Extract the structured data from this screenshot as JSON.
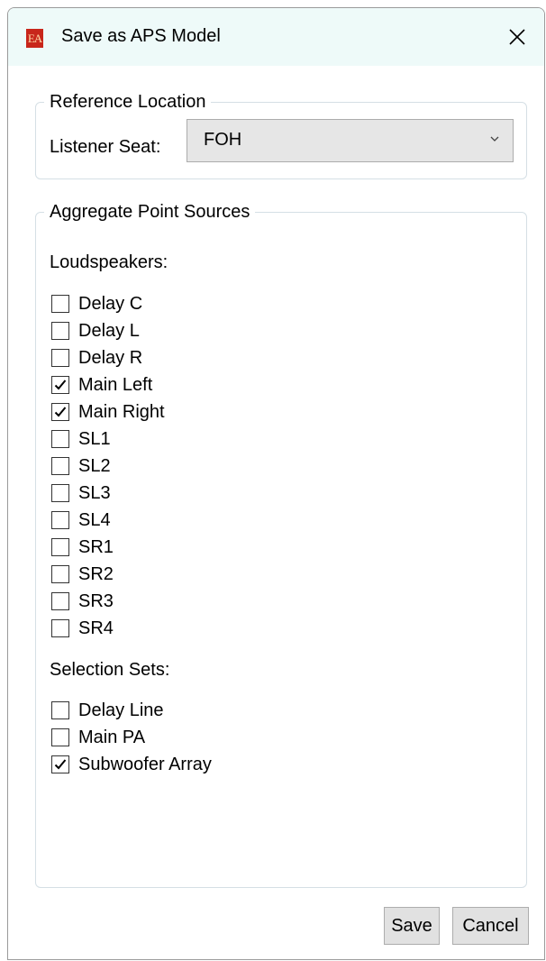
{
  "window": {
    "title": "Save as APS Model",
    "app_icon": "EA-logo-icon",
    "close_icon": "close-icon"
  },
  "reference_location": {
    "legend": "Reference Location",
    "listener_seat_label": "Listener Seat:",
    "listener_seat_value": "FOH"
  },
  "aggregate": {
    "legend": "Aggregate Point Sources",
    "loudspeakers_label": "Loudspeakers:",
    "loudspeakers": [
      {
        "label": "Delay C",
        "checked": false
      },
      {
        "label": "Delay L",
        "checked": false
      },
      {
        "label": "Delay R",
        "checked": false
      },
      {
        "label": "Main Left",
        "checked": true
      },
      {
        "label": "Main Right",
        "checked": true
      },
      {
        "label": "SL1",
        "checked": false
      },
      {
        "label": "SL2",
        "checked": false
      },
      {
        "label": "SL3",
        "checked": false
      },
      {
        "label": "SL4",
        "checked": false
      },
      {
        "label": "SR1",
        "checked": false
      },
      {
        "label": "SR2",
        "checked": false
      },
      {
        "label": "SR3",
        "checked": false
      },
      {
        "label": "SR4",
        "checked": false
      }
    ],
    "selection_sets_label": "Selection Sets:",
    "selection_sets": [
      {
        "label": "Delay Line",
        "checked": false
      },
      {
        "label": "Main PA",
        "checked": false
      },
      {
        "label": "Subwoofer Array",
        "checked": true
      }
    ]
  },
  "buttons": {
    "save": "Save",
    "cancel": "Cancel"
  },
  "colors": {
    "titlebar_bg": "#eefaf9",
    "icon_red": "#c8261b",
    "group_border": "#d5dfe5",
    "button_bg": "#e1e1e1"
  }
}
